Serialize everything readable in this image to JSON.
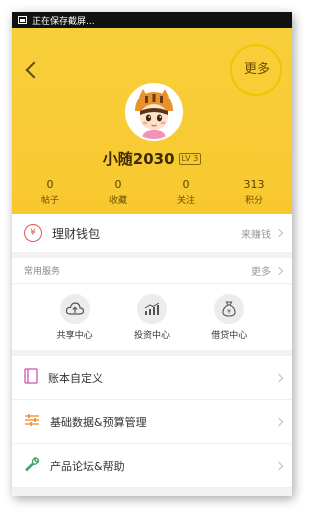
{
  "status_bar": {
    "text": "正在保存截屏..."
  },
  "header": {
    "more_label": "更多",
    "username": "小随2030",
    "level": "LV 3",
    "stats": [
      {
        "value": "0",
        "label": "帖子"
      },
      {
        "value": "0",
        "label": "收藏"
      },
      {
        "value": "0",
        "label": "关注"
      },
      {
        "value": "313",
        "label": "积分"
      }
    ]
  },
  "wallet": {
    "icon_symbol": "¥",
    "label": "理财钱包",
    "right_text": "来赚钱"
  },
  "services": {
    "title": "常用服务",
    "more_label": "更多",
    "items": [
      {
        "label": "共享中心",
        "icon": "cloud-upload-icon"
      },
      {
        "label": "投资中心",
        "icon": "chart-icon"
      },
      {
        "label": "借贷中心",
        "icon": "money-bag-icon"
      }
    ]
  },
  "menu": {
    "items": [
      {
        "label": "账本自定义",
        "icon": "book-icon",
        "color": "#c45ab0"
      },
      {
        "label": "基础数据&预算管理",
        "icon": "sliders-icon",
        "color": "#f08a2a"
      },
      {
        "label": "产品论坛&帮助",
        "icon": "wrench-icon",
        "color": "#3aa46a"
      }
    ]
  },
  "colors": {
    "header_yellow": "#f9c82f",
    "highlight_circle": "#f0c400",
    "wallet_red": "#e05a4a"
  }
}
